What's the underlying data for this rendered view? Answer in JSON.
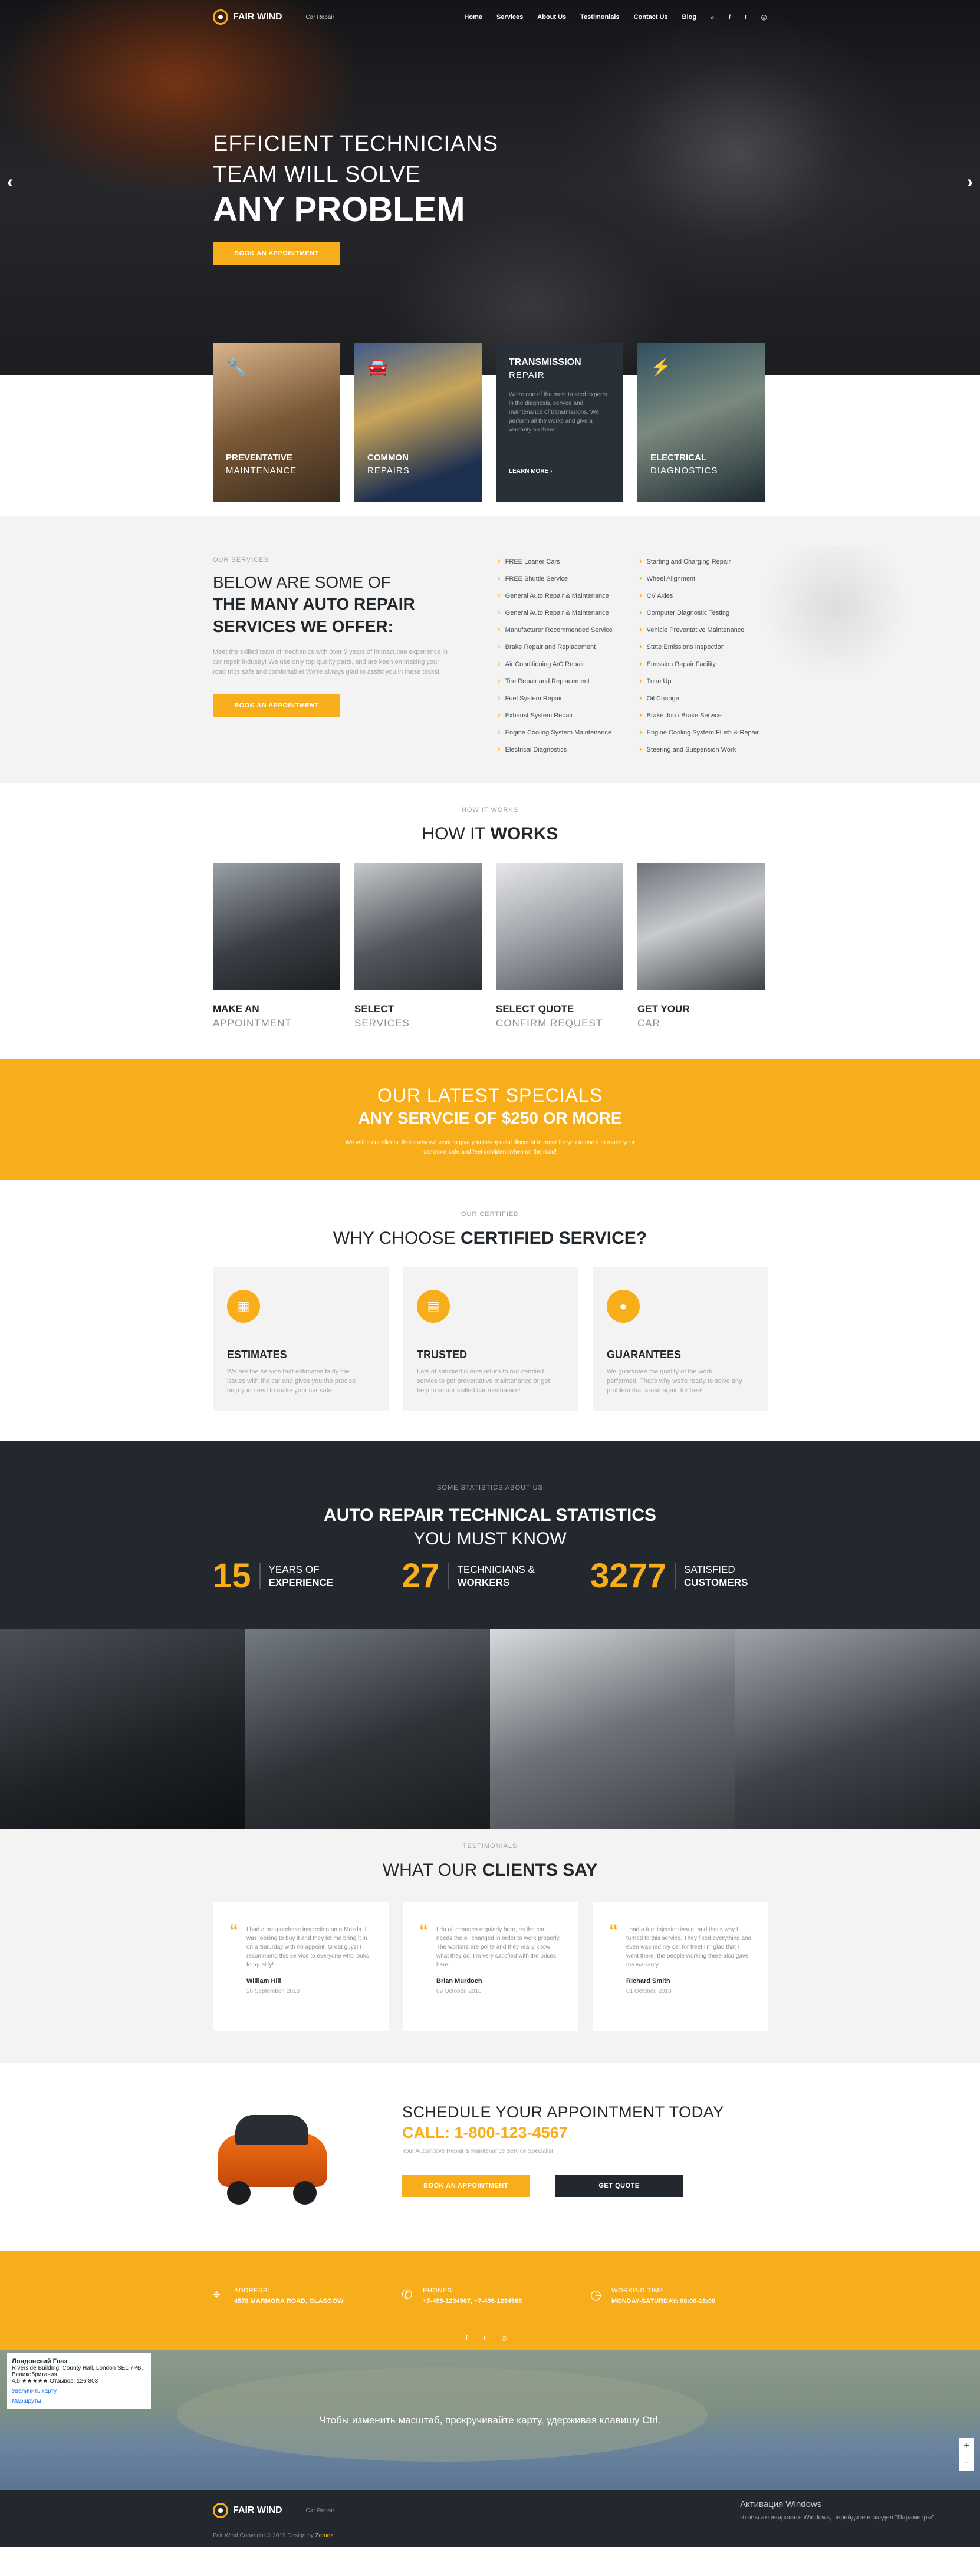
{
  "header": {
    "logo": "FAIR WIND",
    "tagline": "Car Repair",
    "nav": [
      "Home",
      "Services",
      "About Us",
      "Testimonials",
      "Contact Us",
      "Blog"
    ],
    "icons": [
      "search-icon",
      "facebook-icon",
      "twitter-icon",
      "instagram-icon"
    ]
  },
  "hero": {
    "line1": "EFFICIENT TECHNICIANS",
    "line2": "TEAM WILL SOLVE",
    "line3": "ANY PROBLEM",
    "button": "BOOK AN APPOINTMENT",
    "prev": "‹",
    "next": "›"
  },
  "tiles": [
    {
      "t1": "PREVENTATIVE",
      "t2": "MAINTENANCE",
      "icon": "wrench-icon"
    },
    {
      "t1": "COMMON",
      "t2": "REPAIRS",
      "icon": "car-icon"
    },
    {
      "t1": "TRANSMISSION",
      "t2": "REPAIR",
      "desc": "We're one of the most trusted experts in the diagnosis, service and maintenance of transmissions. We perform all the works and give a warranty on them!",
      "more": "LEARN MORE ›"
    },
    {
      "t1": "ELECTRICAL",
      "t2": "DIAGNOSTICS",
      "icon": "bolt-icon"
    }
  ],
  "services": {
    "kicker": "OUR SERVICES",
    "light": "BELOW ARE SOME OF",
    "bold1": "THE MANY AUTO REPAIR",
    "bold2": "SERVICES WE OFFER:",
    "text": "Meet the skilled team of mechanics with over 5 years of immaculate experience in car repair industry! We use only top quality parts, and are keen on making your road trips safe and comfortable! We're always glad to assist you in these tasks!",
    "button": "BOOK AN APPOINTMENT",
    "col1": [
      "FREE Loaner Cars",
      "FREE Shuttle Service",
      "General Auto Repair & Maintenance",
      "General Auto Repair & Maintenance",
      "Manufacturer Recommended Service",
      "Brake Repair and Replacement",
      "Air Conditioning A/C Repair",
      "Tire Repair and Replacement",
      "Fuel System Repair",
      "Exhaust System Repair",
      "Engine Cooling System Maintenance",
      "Electrical Diagnostics"
    ],
    "col2": [
      "Starting and Charging Repair",
      "Wheel Alignment",
      "CV Axles",
      "Computer Diagnostic Testing",
      "Vehicle Preventative Maintenance",
      "State Emissions Inspection",
      "Emission Repair Facility",
      "Tune Up",
      "Oil Change",
      "Brake Job / Brake Service",
      "Engine Cooling System Flush & Repair",
      "Steering and Suspension Work"
    ]
  },
  "how": {
    "kicker": "HOW IT WORKS",
    "light": "HOW IT",
    "bold": "WORKS",
    "steps": [
      {
        "s1": "MAKE AN",
        "s2": "APPOINTMENT"
      },
      {
        "s1": "SELECT",
        "s2": "SERVICES"
      },
      {
        "s1": "SELECT QUOTE",
        "s2": "CONFIRM REQUEST"
      },
      {
        "s1": "GET YOUR",
        "s2": "CAR"
      }
    ]
  },
  "specials": {
    "a": "OUR LATEST SPECIALS",
    "b": "ANY SERVCIE OF $250 OR MORE",
    "c": "We value our clients, that's why we want to give you this special discount in order for you to use it to make your car more safe and feel confident when on the road!"
  },
  "why": {
    "kicker": "OUR CERTIFIED",
    "light": "WHY CHOOSE",
    "bold": "CERTIFIED SERVICE?",
    "cards": [
      {
        "t": "ESTIMATES",
        "d": "We are the service that estimates fairly the issues with the car and gives you the precise help you need to make your car safe!"
      },
      {
        "t": "TRUSTED",
        "d": "Lots of satisfied clients return to our certified service to get preventative maintenance or get help from our skilled car mechanics!"
      },
      {
        "t": "GUARANTEES",
        "d": "We guarantee the quality of the work performed. That's why we're ready to solve any problem that arose again for free!"
      }
    ]
  },
  "stats": {
    "kicker": "SOME STATISTICS ABOUT US",
    "h1": "AUTO REPAIR TECHNICAL STATISTICS",
    "h2": "YOU MUST KNOW",
    "items": [
      {
        "num": "15",
        "a": "YEARS OF",
        "b": "EXPERIENCE"
      },
      {
        "num": "27",
        "a": "TECHNICIANS &",
        "b": "WORKERS"
      },
      {
        "num": "3277",
        "a": "SATISFIED",
        "b": "CUSTOMERS"
      }
    ]
  },
  "testimonials": {
    "kicker": "TESTIMONIALS",
    "light": "WHAT OUR",
    "bold": "CLIENTS SAY",
    "items": [
      {
        "text": "I had a pre-purchase inspection on a Mazda. I was looking to buy it and they let me bring it in on a Saturday with no appoint. Great guys! I recommend this service to everyone who looks for quality!",
        "name": "William Hill",
        "date": "28 September, 2018"
      },
      {
        "text": "I do oil changes regularly here, as the car needs the oil changed in order to work properly. The workers are polite and they really know what they do. I'm very satisfied with the prices here!",
        "name": "Brian Murdoch",
        "date": "09 October, 2018"
      },
      {
        "text": "I had a fuel injection issue, and that's why I turned to this service. They fixed everything and even washed my car for free! I'm glad that I went there, the people working there also gave me warranty.",
        "name": "Richard Smith",
        "date": "01 October, 2018"
      }
    ]
  },
  "schedule": {
    "h": "SCHEDULE YOUR APPOINTMENT TODAY",
    "call": "CALL: 1-800-123-4567",
    "sub": "Your Automotive Repair & Maintenance Service Specialist",
    "btn1": "BOOK AN APPOINTMENT",
    "btn2": "GET QUOTE"
  },
  "contact": {
    "items": [
      {
        "k": "ADDRESS:",
        "v": "4578 MARMORA ROAD, GLASGOW",
        "icon": "pin-icon"
      },
      {
        "k": "PHONES:",
        "v": "+7-495-1234567, +7-495-1234568",
        "icon": "phone-icon"
      },
      {
        "k": "WORKING TIME:",
        "v": "MONDAY-SATURDAY: 08:00-18:00",
        "icon": "clock-icon"
      }
    ],
    "social": "f  t  ◎"
  },
  "map": {
    "card_title": "Лондонский Глаз",
    "card_addr": "Riverside Building, County Hall, London SE1 7PB, Великобритания",
    "card_rating": "4,5 ★★★★★  Отзывов: 126 803",
    "card_link": "Увеличить карту",
    "card_route": "Маршруты",
    "message": "Чтобы изменить масштаб, прокручивайте карту, удерживая клавишу Ctrl.",
    "zoom_in": "+",
    "zoom_out": "−"
  },
  "footer": {
    "logo": "FAIR WIND",
    "tagline": "Car Repair",
    "copy": "Fair Wind Copyright © 2019 Design by ",
    "copy_link": "Zemez",
    "win1": "Активация Windows",
    "win2": "Чтобы активировать Windows, перейдите в раздел \"Параметры\"."
  }
}
